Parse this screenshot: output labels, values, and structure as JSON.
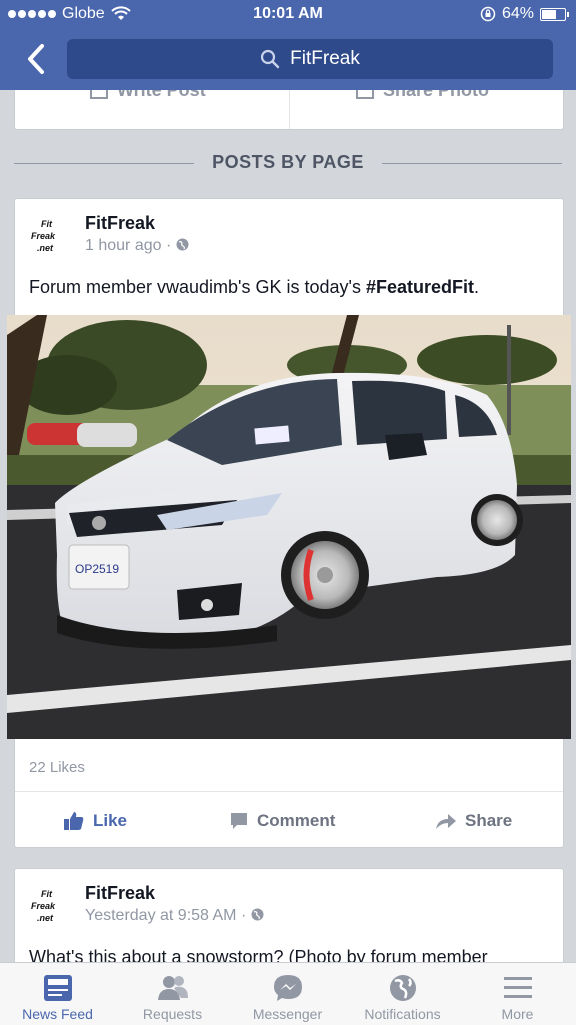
{
  "status": {
    "carrier": "Globe",
    "time": "10:01 AM",
    "battery": "64%"
  },
  "nav": {
    "search_text": "FitFreak"
  },
  "composer": {
    "write_post": "Write Post",
    "share_photo": "Share Photo"
  },
  "section_title": "POSTS BY PAGE",
  "post1": {
    "logo": {
      "line1": "Fit",
      "line2": "Freak",
      "line3": ".net"
    },
    "page_name": "FitFreak",
    "time": "1 hour ago",
    "text_prefix": "Forum member vwaudimb's GK is today's ",
    "text_hashtag": "#FeaturedFit",
    "text_suffix": ".",
    "plate": "OP2519",
    "likes": "22 Likes",
    "actions": {
      "like": "Like",
      "comment": "Comment",
      "share": "Share"
    }
  },
  "post2": {
    "logo": {
      "line1": "Fit",
      "line2": "Freak",
      "line3": ".net"
    },
    "page_name": "FitFreak",
    "time": "Yesterday at 9:58 AM",
    "text": "What's this about a snowstorm? (Photo by forum member"
  },
  "tabs": [
    {
      "label": "News Feed",
      "icon": "news-feed-icon",
      "active": true
    },
    {
      "label": "Requests",
      "icon": "friend-requests-icon",
      "active": false
    },
    {
      "label": "Messenger",
      "icon": "messenger-icon",
      "active": false
    },
    {
      "label": "Notifications",
      "icon": "globe-icon",
      "active": false
    },
    {
      "label": "More",
      "icon": "menu-icon",
      "active": false
    }
  ],
  "colors": {
    "brand": "#4a67ad",
    "background": "#d3d6db",
    "muted": "#9197a3"
  }
}
